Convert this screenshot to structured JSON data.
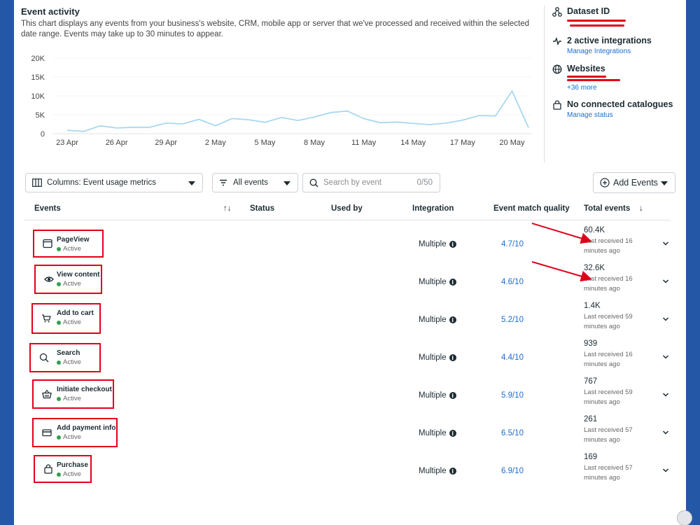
{
  "header": {
    "title": "Event activity",
    "description": "This chart displays any events from your business's website, CRM, mobile app or server that we've processed and received within the selected date range. Events may take up to 30 minutes to appear."
  },
  "chart_data": {
    "type": "line",
    "y_ticks": [
      "20K",
      "15K",
      "10K",
      "5K",
      "0"
    ],
    "ylim": [
      0,
      20000
    ],
    "x_ticks": [
      "23 Apr",
      "26 Apr",
      "29 Apr",
      "2 May",
      "5 May",
      "8 May",
      "11 May",
      "14 May",
      "17 May",
      "20 May"
    ],
    "series": [
      {
        "color": "#a8d8f0",
        "values": [
          900,
          600,
          2100,
          1500,
          1700,
          1700,
          2800,
          2600,
          3800,
          2100,
          4000,
          3700,
          3000,
          4300,
          3500,
          4400,
          5600,
          6000,
          4000,
          2900,
          3100,
          2700,
          2400,
          2800,
          3600,
          4800,
          4700,
          11300,
          1600
        ]
      }
    ]
  },
  "info": {
    "dataset_title": "Dataset ID",
    "integrations_title": "2 active integrations",
    "integrations_link": "Manage Integrations",
    "websites_title": "Websites",
    "websites_more": "+36 more",
    "catalogues_title": "No connected catalogues",
    "catalogues_link": "Manage status"
  },
  "controls": {
    "columns_label": "Columns: Event usage metrics",
    "filter_label": "All events",
    "search_placeholder": "Search by event",
    "search_count": "0/50",
    "add_events_label": "Add Events"
  },
  "table": {
    "headers": {
      "events": "Events",
      "sort": "↑↓",
      "status": "Status",
      "used_by": "Used by",
      "integration": "Integration",
      "emq": "Event match quality",
      "total": "Total events"
    },
    "rows": [
      {
        "name": "PageView",
        "status": "Active",
        "integration": "Multiple",
        "emq": "4.7/10",
        "total": "60.4K",
        "last": "Last received 16 minutes ago",
        "icon": "browser-window-icon"
      },
      {
        "name": "View content",
        "status": "Active",
        "integration": "Multiple",
        "emq": "4.6/10",
        "total": "32.6K",
        "last": "Last received 16 minutes ago",
        "icon": "eye-icon"
      },
      {
        "name": "Add to cart",
        "status": "Active",
        "integration": "Multiple",
        "emq": "5.2/10",
        "total": "1.4K",
        "last": "Last received 59 minutes ago",
        "icon": "cart-icon"
      },
      {
        "name": "Search",
        "status": "Active",
        "integration": "Multiple",
        "emq": "4.4/10",
        "total": "939",
        "last": "Last received 16 minutes ago",
        "icon": "search-icon"
      },
      {
        "name": "Initiate checkout",
        "status": "Active",
        "integration": "Multiple",
        "emq": "5.9/10",
        "total": "767",
        "last": "Last received 59 minutes ago",
        "icon": "basket-icon"
      },
      {
        "name": "Add payment info",
        "status": "Active",
        "integration": "Multiple",
        "emq": "6.5/10",
        "total": "261",
        "last": "Last received 57 minutes ago",
        "icon": "credit-card-icon"
      },
      {
        "name": "Purchase",
        "status": "Active",
        "integration": "Multiple",
        "emq": "6.9/10",
        "total": "169",
        "last": "Last received 57 minutes ago",
        "icon": "shopping-bag-icon"
      }
    ]
  },
  "colors": {
    "annotation_red": "#e0001b",
    "link_blue": "#1c6dd0",
    "active_green": "#31a24c",
    "chart_line": "#a8d8f0",
    "background_blue": "#2557a7"
  }
}
